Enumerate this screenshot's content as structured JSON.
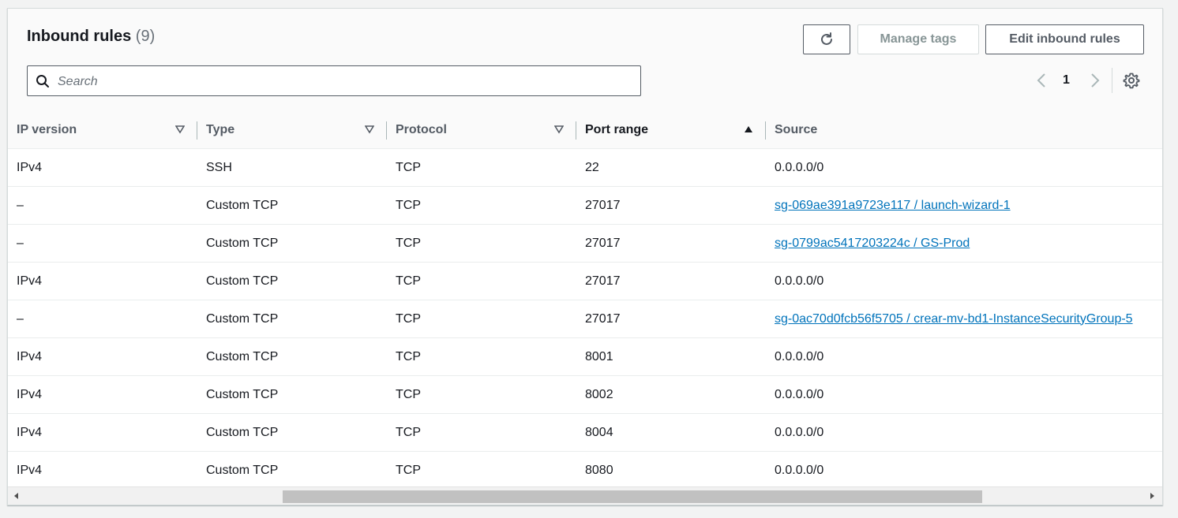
{
  "panel": {
    "title": "Inbound rules",
    "count": "(9)"
  },
  "toolbar": {
    "refresh_icon": "refresh-icon",
    "manage_tags_label": "Manage tags",
    "edit_label": "Edit inbound rules"
  },
  "search": {
    "placeholder": "Search",
    "value": ""
  },
  "pagination": {
    "current_page": "1"
  },
  "table": {
    "columns": [
      "IP version",
      "Type",
      "Protocol",
      "Port range",
      "Source"
    ],
    "sorted_column": "Port range",
    "rows": [
      {
        "ip_version": "IPv4",
        "type": "SSH",
        "protocol": "TCP",
        "port_range": "22",
        "source": "0.0.0.0/0"
      },
      {
        "ip_version": "–",
        "type": "Custom TCP",
        "protocol": "TCP",
        "port_range": "27017",
        "source": "sg-069ae391a9723e117 / launch-wizard-1"
      },
      {
        "ip_version": "–",
        "type": "Custom TCP",
        "protocol": "TCP",
        "port_range": "27017",
        "source": "sg-0799ac5417203224c / GS-Prod"
      },
      {
        "ip_version": "IPv4",
        "type": "Custom TCP",
        "protocol": "TCP",
        "port_range": "27017",
        "source": "0.0.0.0/0"
      },
      {
        "ip_version": "–",
        "type": "Custom TCP",
        "protocol": "TCP",
        "port_range": "27017",
        "source": "sg-0ac70d0fcb56f5705 / crear-mv-bd1-InstanceSecurityGroup-5"
      },
      {
        "ip_version": "IPv4",
        "type": "Custom TCP",
        "protocol": "TCP",
        "port_range": "8001",
        "source": "0.0.0.0/0"
      },
      {
        "ip_version": "IPv4",
        "type": "Custom TCP",
        "protocol": "TCP",
        "port_range": "8002",
        "source": "0.0.0.0/0"
      },
      {
        "ip_version": "IPv4",
        "type": "Custom TCP",
        "protocol": "TCP",
        "port_range": "8004",
        "source": "0.0.0.0/0"
      },
      {
        "ip_version": "IPv4",
        "type": "Custom TCP",
        "protocol": "TCP",
        "port_range": "8080",
        "source": "0.0.0.0/0"
      }
    ]
  },
  "colors": {
    "link": "#0073bb",
    "border": "#545b64",
    "header_bg": "#fafafa"
  }
}
